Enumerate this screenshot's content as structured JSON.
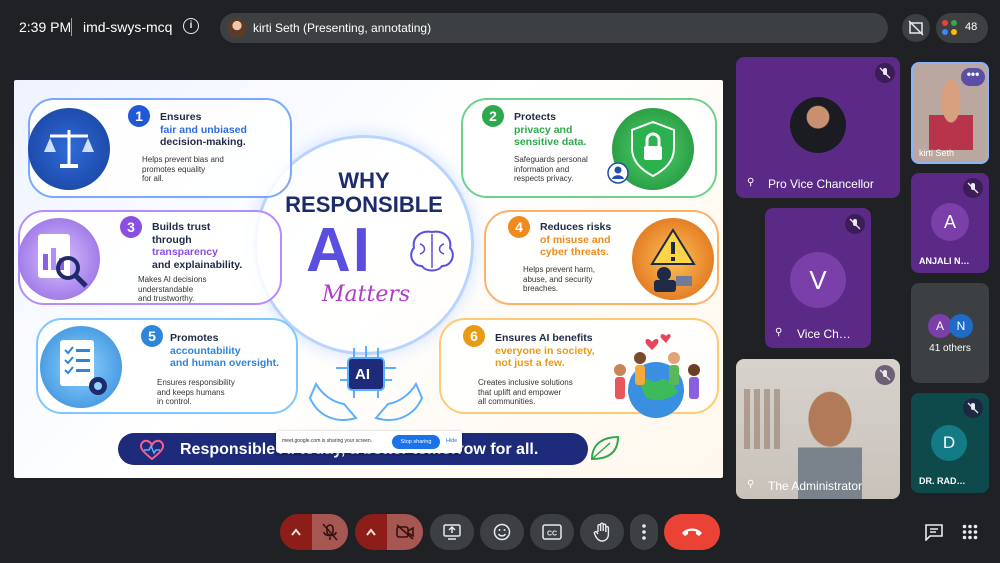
{
  "header": {
    "time": "2:39 PM",
    "meeting_code": "imd-swys-mcq",
    "presenter_status": "kirti Seth (Presenting, annotating)",
    "participant_count": "48"
  },
  "slide": {
    "title_line1": "WHY",
    "title_line2": "RESPONSIBLE",
    "title_ai": "AI",
    "title_matters": "Matters",
    "cards": [
      {
        "number": "1",
        "title": "Ensures",
        "highlight": "fair and unbiased",
        "title2": "decision-making.",
        "desc1": "Helps prevent bias and",
        "desc2": "promotes equality",
        "desc3": "for all."
      },
      {
        "number": "2",
        "title": "Protects",
        "highlight": "privacy and",
        "title2": "sensitive data.",
        "desc1": "Safeguards personal",
        "desc2": "information and",
        "desc3": "respects privacy."
      },
      {
        "number": "3",
        "title": "Builds trust",
        "title2": "through",
        "highlight": "transparency",
        "title3": "and explainability.",
        "desc1": "Makes AI decisions",
        "desc2": "understandable",
        "desc3": "and trustworthy."
      },
      {
        "number": "4",
        "title": "Reduces risks",
        "highlight": "of misuse and",
        "title2": "cyber threats.",
        "desc1": "Helps prevent harm,",
        "desc2": "abuse, and security",
        "desc3": "breaches."
      },
      {
        "number": "5",
        "title": "Promotes",
        "highlight": "accountability",
        "title2": "and human oversight.",
        "desc1": "Ensures responsibility",
        "desc2": "and keeps humans",
        "desc3": "in control."
      },
      {
        "number": "6",
        "title": "Ensures AI benefits",
        "highlight": "everyone in society,",
        "title2": "not just a few.",
        "desc1": "Creates inclusive solutions",
        "desc2": "that uplift and empower",
        "desc3": "all communities."
      }
    ],
    "banner_text": "Responsible AI today, a better tomorrow for all.",
    "chip_ai": "AI",
    "share_notice": "meet.google.com is sharing your screen.",
    "stop_sharing": "Stop sharing",
    "hide": "Hide"
  },
  "participants": {
    "pro_vc": "Pro Vice Chancellor",
    "vc": "Vice Ch…",
    "vc_initial": "V",
    "admin": "The Administrator",
    "kirti": "kirti Seth",
    "anjali": "ANJALI N…",
    "anjali_initial": "A",
    "others_label": "41 others",
    "others_a": "A",
    "others_n": "N",
    "dr": "DR. RAD…",
    "dr_initial": "D"
  },
  "colors": {
    "purple_tile": "#5b2a86",
    "end_call": "#ea4335",
    "muted_control": "#8c1d18",
    "control_gray": "#3c4043"
  }
}
